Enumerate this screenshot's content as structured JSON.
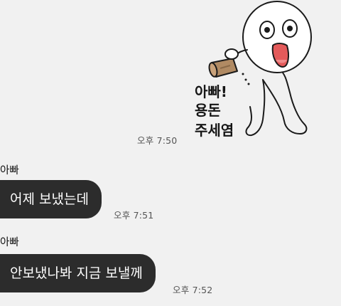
{
  "messages": [
    {
      "type": "sticker",
      "direction": "outgoing",
      "sticker_text": [
        "아빠!",
        "용돈",
        "주세염"
      ],
      "time": "오후 7:50"
    },
    {
      "type": "text",
      "direction": "incoming",
      "sender": "아빠",
      "text": "어제 보냈는데",
      "time": "오후 7:51"
    },
    {
      "type": "text",
      "direction": "incoming",
      "sender": "아빠",
      "text": "안보냈나봐 지금 보낼께",
      "time": "오후 7:52"
    }
  ],
  "colors": {
    "background": "#f1f1f1",
    "incoming_bubble": "#2c2c2c",
    "incoming_text": "#ffffff"
  }
}
